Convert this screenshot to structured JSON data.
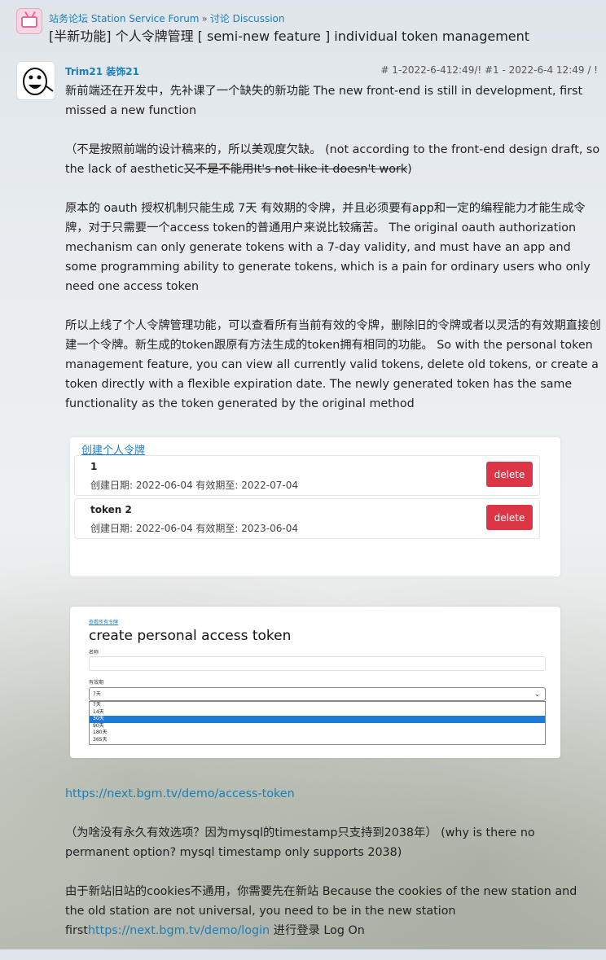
{
  "header": {
    "forum_name": "站务论坛 Station Service Forum",
    "separator": "»",
    "category": "讨论 Discussion",
    "title": "[半新功能] 个人令牌管理 [ semi-new feature ] individual token management"
  },
  "post": {
    "username": "Trim21 装饰21",
    "meta": "# 1-2022-6-412:49/! #1 - 2022-6-4 12:49 / !",
    "p1": "新前端还在开发中，先补课了一个缺失的新功能 The new front-end is still in development, first missed a new function",
    "p2_plain": "（不是按照前端的设计稿来的，所以美观度欠缺。 (not according to the front-end design draft, so the lack of aesthetic",
    "p2_strike": "又不是不能用It's not like it doesn't work",
    "p2_end": ")",
    "p3": "原本的 oauth 授权机制只能生成 7天 有效期的令牌，并且必须要有app和一定的编程能力才能生成令牌，对于只需要一个access token的普通用户来说比较痛苦。 The original oauth authorization mechanism can only generate tokens with a 7-day validity, and must have an app and some programming ability to generate tokens, which is a pain for ordinary users who only need one access token",
    "p4": "所以上线了个人令牌管理功能，可以查看所有当前有效的令牌，删除旧的令牌或者以灵活的有效期直接创建一个令牌。新生成的token跟原有方法生成的token拥有相同的功能。 So with the personal token management feature, you can view all currently valid tokens, delete old tokens, or create a token directly with a flexible expiration date. The newly generated token has the same functionality as the token generated by the original method"
  },
  "token_list": {
    "create_link": "创建个人令牌",
    "tokens": [
      {
        "name": "1",
        "dates": "创建日期:  2022-06-04 有效期至:  2022-07-04",
        "delete_label": "delete"
      },
      {
        "name": "token 2",
        "dates": "创建日期:  2022-06-04 有效期至:  2023-06-04",
        "delete_label": "delete"
      }
    ]
  },
  "create_form": {
    "back_link": "查看所有令牌",
    "heading": "create personal access token",
    "name_label": "名称",
    "expiry_label": "有效期",
    "selected_value": "7天",
    "options": [
      "7天",
      "14天",
      "30天",
      "90天",
      "180天",
      "365天"
    ],
    "highlighted_option": "30天"
  },
  "lower": {
    "demo_link": "https://next.bgm.tv/demo/access-token",
    "p_mysql": "（为啥没有永久有效选项？因为mysql的timestamp只支持到2038年） (why is there no permanent option? mysql timestamp only supports 2038)",
    "p_cookie_start": "由于新站旧站的cookies不通用，你需要先在新站 Because the cookies of the new station and the old station are not universal, you need to be in the new station first",
    "login_link": "https://next.bgm.tv/demo/login",
    "p_cookie_end": " 进行登录 Log On"
  },
  "colors": {
    "link": "#1b7fb8",
    "delete_button": "#dc3545",
    "option_highlight": "#1e7ad6"
  }
}
